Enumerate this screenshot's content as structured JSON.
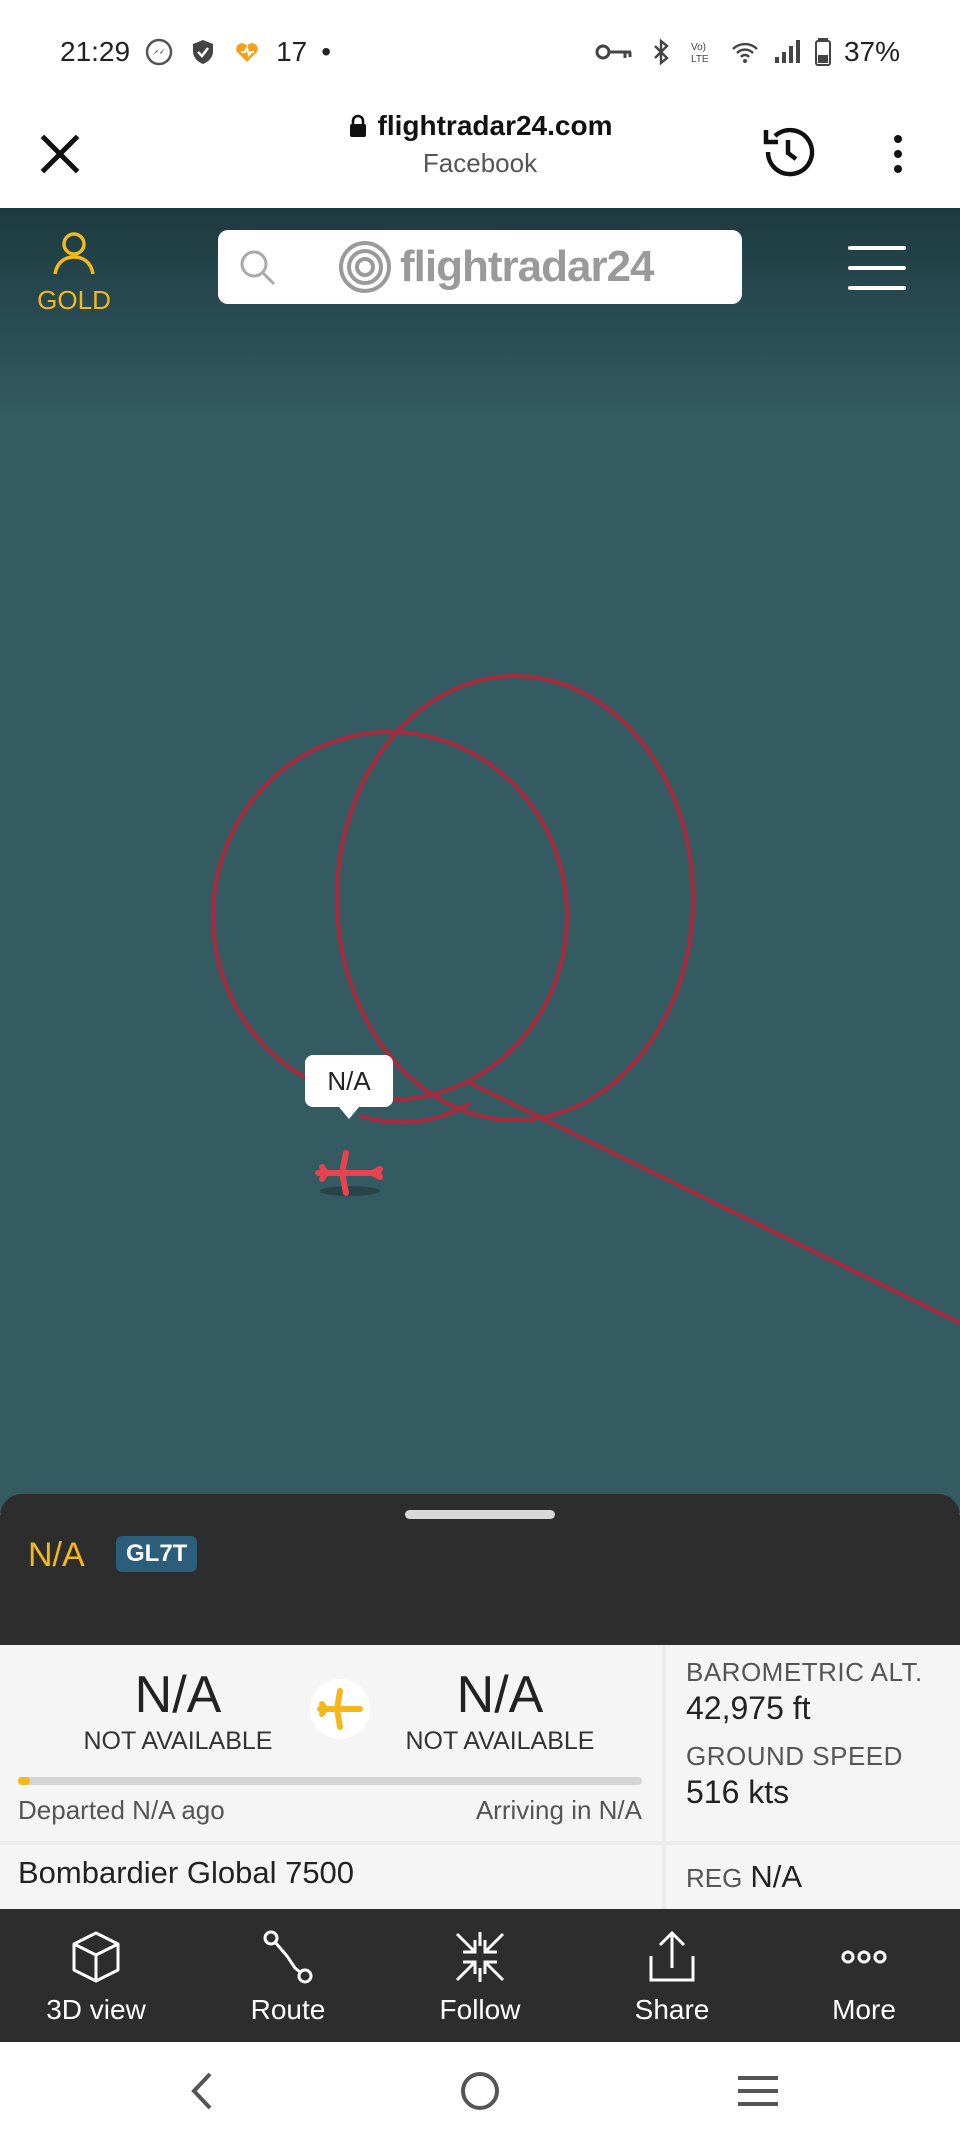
{
  "status_bar": {
    "time": "21:29",
    "notification_count": "17",
    "dot": "•",
    "battery": "37%",
    "icons": [
      "facebook-messenger-icon",
      "shield-icon",
      "heart-notification-icon",
      "vpn-key-icon",
      "bluetooth-icon",
      "volte-icon",
      "wifi-icon",
      "signal-icon",
      "battery-icon"
    ]
  },
  "browser": {
    "url": "flightradar24.com",
    "subtitle": "Facebook"
  },
  "app_header": {
    "gold_label": "GOLD",
    "logo_text": "flightradar24",
    "accent_color": "#f4b81c"
  },
  "map": {
    "callsign_tag": "N/A",
    "track_color": "#a8283c",
    "background_color": "#345b62",
    "aircraft_color": "#e8424e"
  },
  "flight_panel": {
    "callsign": "N/A",
    "aircraft_code": "GL7T",
    "origin": {
      "code": "N/A",
      "name": "NOT AVAILABLE"
    },
    "destination": {
      "code": "N/A",
      "name": "NOT AVAILABLE"
    },
    "progress_fraction": 0.02,
    "departed": "Departed N/A ago",
    "arriving": "Arriving in N/A",
    "baro_alt_label": "BAROMETRIC ALT.",
    "baro_alt_value": "42,975 ft",
    "ground_speed_label": "GROUND SPEED",
    "ground_speed_value": "516 kts",
    "aircraft_type": "Bombardier Global 7500",
    "reg_label": "REG",
    "reg_value": "N/A"
  },
  "actions": [
    {
      "label": "3D view",
      "icon": "cube-icon"
    },
    {
      "label": "Route",
      "icon": "route-icon"
    },
    {
      "label": "Follow",
      "icon": "follow-icon"
    },
    {
      "label": "Share",
      "icon": "share-icon"
    },
    {
      "label": "More",
      "icon": "more-icon"
    }
  ]
}
